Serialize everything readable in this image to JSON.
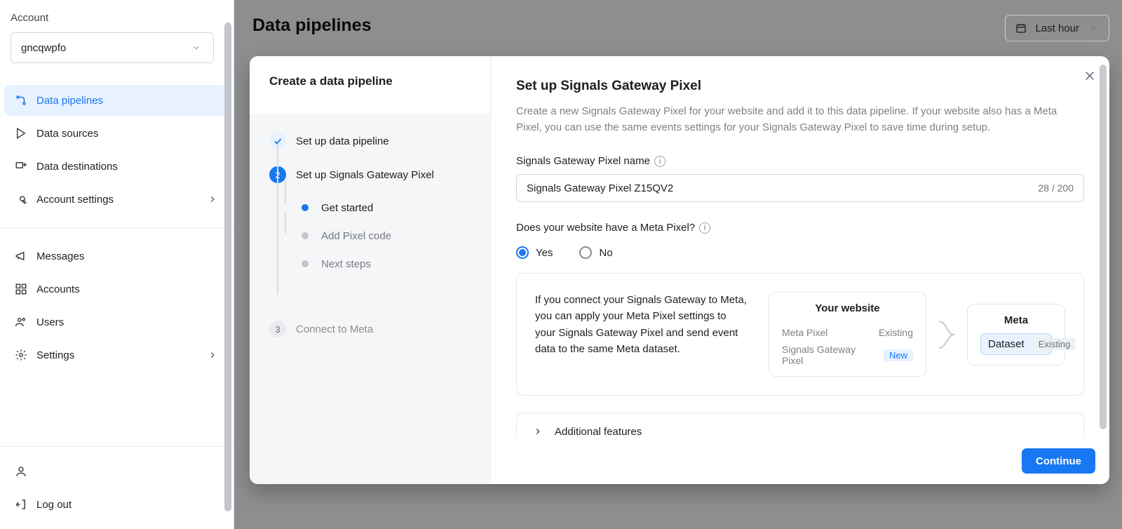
{
  "sidebar": {
    "account_label": "Account",
    "account_value": "gncqwpfo",
    "nav1": [
      {
        "label": "Data pipelines"
      },
      {
        "label": "Data sources"
      },
      {
        "label": "Data destinations"
      },
      {
        "label": "Account settings"
      }
    ],
    "nav2": [
      {
        "label": "Messages"
      },
      {
        "label": "Accounts"
      },
      {
        "label": "Users"
      },
      {
        "label": "Settings"
      }
    ],
    "logout_label": "Log out"
  },
  "page": {
    "title": "Data pipelines",
    "time_range": "Last hour"
  },
  "modal": {
    "title": "Create a data pipeline",
    "steps": {
      "s1": "Set up data pipeline",
      "s2": "Set up Signals Gateway Pixel",
      "s3": "Connect to Meta",
      "sub1": "Get started",
      "sub2": "Add Pixel code",
      "sub3": "Next steps",
      "num2": "2",
      "num3": "3"
    },
    "main": {
      "title": "Set up Signals Gateway Pixel",
      "description": "Create a new Signals Gateway Pixel for your website and add it to this data pipeline. If your website also has a Meta Pixel, you can use the same events settings for your Signals Gateway Pixel to save time during setup.",
      "name_label": "Signals Gateway Pixel name",
      "name_value": "Signals Gateway Pixel Z15QV2",
      "name_counter": "28 / 200",
      "meta_question": "Does your website have a Meta Pixel?",
      "yes": "Yes",
      "no": "No",
      "info_text": "If you connect your Signals Gateway to Meta, you can apply your Meta Pixel settings to your Signals Gateway Pixel and send event data to the same Meta dataset.",
      "diagram": {
        "col1_title": "Your website",
        "col2_title": "Meta",
        "row1": "Meta Pixel",
        "row1_badge": "Existing",
        "row2": "Signals Gateway Pixel",
        "row2_badge": "New",
        "dataset": "Dataset",
        "dataset_badge": "Existing"
      },
      "additional": "Additional features",
      "continue": "Continue"
    }
  }
}
